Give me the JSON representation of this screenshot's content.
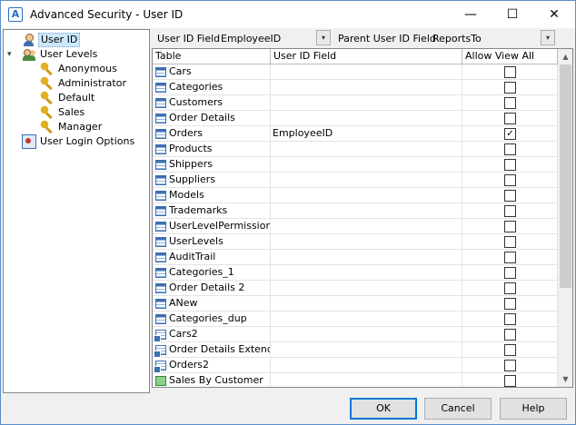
{
  "window": {
    "title": "Advanced Security - User ID",
    "app_icon_letter": "A",
    "min_glyph": "—",
    "max_glyph": "☐",
    "close_glyph": "✕"
  },
  "tree": {
    "items": [
      {
        "label": "User ID",
        "icon": "user-icon",
        "selected": true
      },
      {
        "label": "User Levels",
        "icon": "users-icon",
        "expanded": true
      },
      {
        "label": "Anonymous",
        "icon": "key-icon"
      },
      {
        "label": "Administrator",
        "icon": "key-icon"
      },
      {
        "label": "Default",
        "icon": "key-icon"
      },
      {
        "label": "Sales",
        "icon": "key-icon"
      },
      {
        "label": "Manager",
        "icon": "key-icon"
      },
      {
        "label": "User Login Options",
        "icon": "login-options-icon"
      }
    ],
    "expander_glyph": "▾"
  },
  "toolbar": {
    "user_id_field_label": "User ID Field",
    "user_id_field_value": "EmployeeID",
    "parent_user_id_field_label": "Parent User ID Field",
    "parent_user_id_field_value": "ReportsTo",
    "dropdown_glyph": "▾"
  },
  "grid": {
    "columns": [
      "Table",
      "User ID Field",
      "Allow View All"
    ],
    "rows": [
      {
        "table": "Cars",
        "user_id_field": "",
        "allow_view_all": false,
        "icon": "table-icon"
      },
      {
        "table": "Categories",
        "user_id_field": "",
        "allow_view_all": false,
        "icon": "table-icon"
      },
      {
        "table": "Customers",
        "user_id_field": "",
        "allow_view_all": false,
        "icon": "table-icon"
      },
      {
        "table": "Order Details",
        "user_id_field": "",
        "allow_view_all": false,
        "icon": "table-icon"
      },
      {
        "table": "Orders",
        "user_id_field": "EmployeeID",
        "allow_view_all": true,
        "icon": "table-icon"
      },
      {
        "table": "Products",
        "user_id_field": "",
        "allow_view_all": false,
        "icon": "table-icon"
      },
      {
        "table": "Shippers",
        "user_id_field": "",
        "allow_view_all": false,
        "icon": "table-icon"
      },
      {
        "table": "Suppliers",
        "user_id_field": "",
        "allow_view_all": false,
        "icon": "table-icon"
      },
      {
        "table": "Models",
        "user_id_field": "",
        "allow_view_all": false,
        "icon": "table-icon"
      },
      {
        "table": "Trademarks",
        "user_id_field": "",
        "allow_view_all": false,
        "icon": "table-icon"
      },
      {
        "table": "UserLevelPermissions",
        "user_id_field": "",
        "allow_view_all": false,
        "icon": "table-icon"
      },
      {
        "table": "UserLevels",
        "user_id_field": "",
        "allow_view_all": false,
        "icon": "table-icon"
      },
      {
        "table": "AuditTrail",
        "user_id_field": "",
        "allow_view_all": false,
        "icon": "table-icon"
      },
      {
        "table": "Categories_1",
        "user_id_field": "",
        "allow_view_all": false,
        "icon": "table-icon"
      },
      {
        "table": "Order Details 2",
        "user_id_field": "",
        "allow_view_all": false,
        "icon": "table-icon"
      },
      {
        "table": "ANew",
        "user_id_field": "",
        "allow_view_all": false,
        "icon": "table-icon"
      },
      {
        "table": "Categories_dup",
        "user_id_field": "",
        "allow_view_all": false,
        "icon": "table-icon"
      },
      {
        "table": "Cars2",
        "user_id_field": "",
        "allow_view_all": false,
        "icon": "view-icon"
      },
      {
        "table": "Order Details Extended",
        "user_id_field": "",
        "allow_view_all": false,
        "icon": "view-icon"
      },
      {
        "table": "Orders2",
        "user_id_field": "",
        "allow_view_all": false,
        "icon": "view-icon"
      },
      {
        "table": "Sales By Customer",
        "user_id_field": "",
        "allow_view_all": false,
        "icon": "stored-procedure-icon"
      }
    ],
    "check_glyph": "✓"
  },
  "scrollbar": {
    "up_glyph": "▲",
    "down_glyph": "▼"
  },
  "buttons": {
    "ok": "OK",
    "cancel": "Cancel",
    "help": "Help"
  }
}
